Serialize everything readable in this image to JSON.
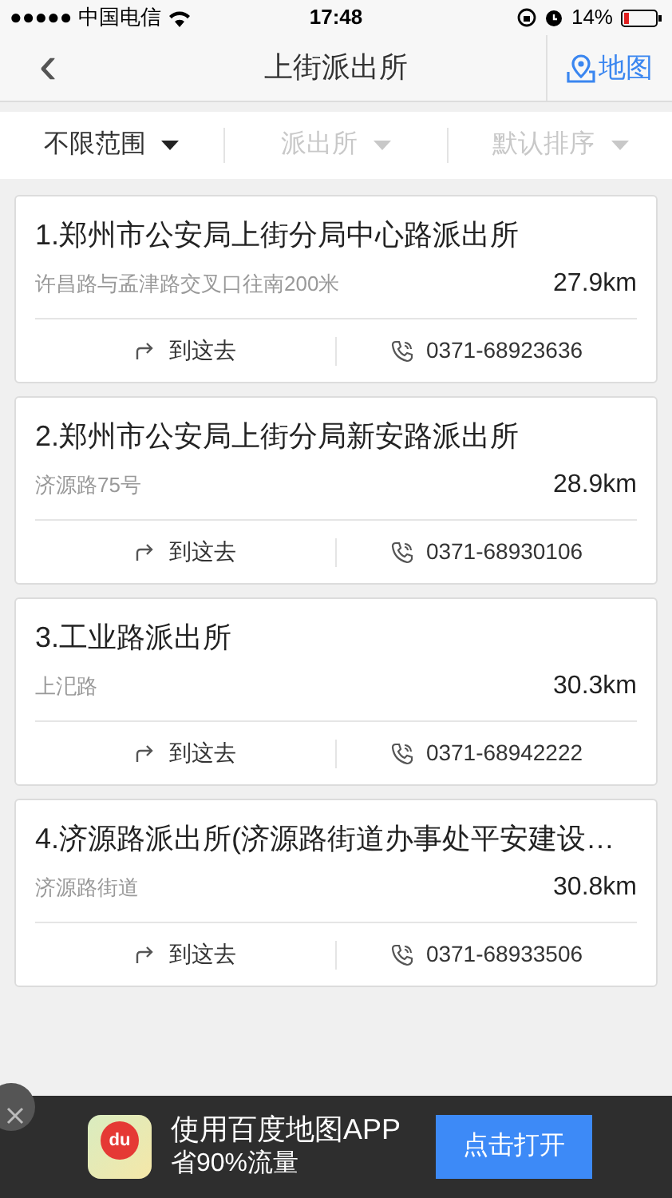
{
  "status_bar": {
    "carrier": "●●●●● 中国电信",
    "time": "17:48",
    "battery": "14%"
  },
  "nav": {
    "back": "‹",
    "title": "上街派出所",
    "map_link": "地图"
  },
  "filters": [
    {
      "label": "不限范围",
      "enabled": true
    },
    {
      "label": "派出所",
      "enabled": false
    },
    {
      "label": "默认排序",
      "enabled": false
    }
  ],
  "results": [
    {
      "name": "1.郑州市公安局上街分局中心路派出所",
      "address": "许昌路与孟津路交叉口往南200米",
      "distance": "27.9km",
      "route": "到这去",
      "phone": "0371-68923636"
    },
    {
      "name": "2.郑州市公安局上街分局新安路派出所",
      "address": "济源路75号",
      "distance": "28.9km",
      "route": "到这去",
      "phone": "0371-68930106"
    },
    {
      "name": "3.工业路派出所",
      "address": "上汜路",
      "distance": "30.3km",
      "route": "到这去",
      "phone": "0371-68942222"
    },
    {
      "name": "4.济源路派出所(济源路街道办事处平安建设…",
      "address": "济源路街道",
      "distance": "30.8km",
      "route": "到这去",
      "phone": "0371-68933506"
    }
  ],
  "banner": {
    "title": "使用百度地图APP",
    "subtitle": "省90%流量",
    "button": "点击打开",
    "app_icon_text": "du"
  }
}
